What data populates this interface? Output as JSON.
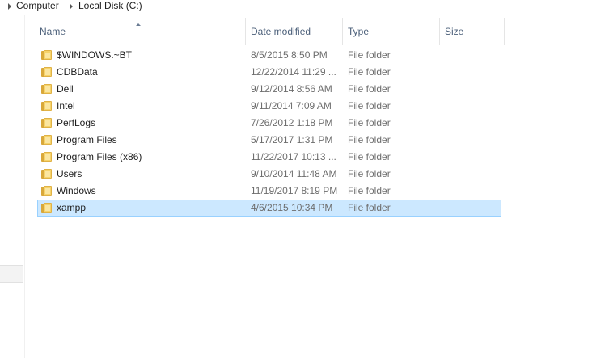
{
  "breadcrumb": {
    "items": [
      "Computer",
      "Local Disk (C:)"
    ]
  },
  "columns": {
    "name": "Name",
    "date_modified": "Date modified",
    "type": "Type",
    "size": "Size"
  },
  "files": [
    {
      "name": "$WINDOWS.~BT",
      "date": "8/5/2015 8:50 PM",
      "type": "File folder",
      "icon": "folder-icon"
    },
    {
      "name": "CDBData",
      "date": "12/22/2014 11:29 ...",
      "type": "File folder",
      "icon": "folder-icon"
    },
    {
      "name": "Dell",
      "date": "9/12/2014 8:56 AM",
      "type": "File folder",
      "icon": "folder-icon"
    },
    {
      "name": "Intel",
      "date": "9/11/2014 7:09 AM",
      "type": "File folder",
      "icon": "folder-icon"
    },
    {
      "name": "PerfLogs",
      "date": "7/26/2012 1:18 PM",
      "type": "File folder",
      "icon": "folder-icon"
    },
    {
      "name": "Program Files",
      "date": "5/17/2017 1:31 PM",
      "type": "File folder",
      "icon": "folder-icon"
    },
    {
      "name": "Program Files (x86)",
      "date": "11/22/2017 10:13 ...",
      "type": "File folder",
      "icon": "folder-icon"
    },
    {
      "name": "Users",
      "date": "9/10/2014 11:48 AM",
      "type": "File folder",
      "icon": "folder-icon"
    },
    {
      "name": "Windows",
      "date": "11/19/2017 8:19 PM",
      "type": "File folder",
      "icon": "folder-icon"
    },
    {
      "name": "xampp",
      "date": "4/6/2015 10:34 PM",
      "type": "File folder",
      "icon": "folder-icon",
      "selected": true
    }
  ],
  "colors": {
    "selection_bg": "#cce8ff",
    "selection_border": "#99d1ff",
    "header_text": "#4c607a",
    "folder_yellow": "#f6d36b"
  }
}
